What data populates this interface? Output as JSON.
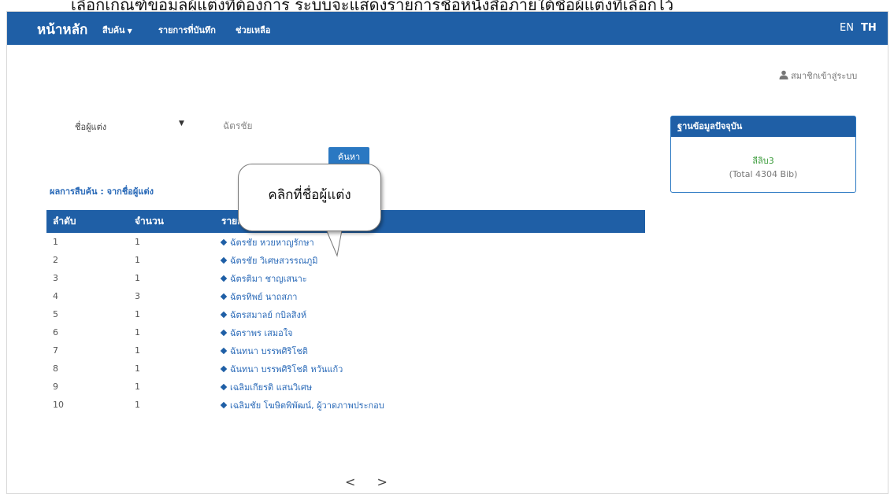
{
  "caption_fragment": "เลือกเกณฑ์ขอมูลผู้แต่งที่ต้องการ ระบบจะแสดงรายการชื่อหนังสือภายใต้ชื่อผู้แต่งที่เลือกไว้",
  "nav": {
    "brand": "หน้าหลัก",
    "search": "สืบค้น",
    "saved": "รายการที่บันทึก",
    "help": "ช่วยเหลือ",
    "lang_en": "EN",
    "lang_th": "TH"
  },
  "login": "สมาชิกเข้าสู่ระบบ",
  "search": {
    "field": "ชื่อผู้แต่ง",
    "term": "ฉัตรชัย",
    "button": "ค้นหา"
  },
  "result_caption": "ผลการสืบค้น : จากชื่อผู้แต่ง",
  "table": {
    "headers": [
      "ลำดับ",
      "จำนวน",
      "รายการ"
    ],
    "rows": [
      {
        "no": "1",
        "count": "1",
        "name": "ฉัตรชัย หวยหาญรักษา"
      },
      {
        "no": "2",
        "count": "1",
        "name": "ฉัตรชัย วิเศษสวรรณภูมิ"
      },
      {
        "no": "3",
        "count": "1",
        "name": "ฉัตรติมา ชาญเสนาะ"
      },
      {
        "no": "4",
        "count": "3",
        "name": "ฉัตรทิพย์ นาถสภา"
      },
      {
        "no": "5",
        "count": "1",
        "name": "ฉัตรสมาลย์ กบิลสิงห์"
      },
      {
        "no": "6",
        "count": "1",
        "name": "ฉัตราพร เสมอใจ"
      },
      {
        "no": "7",
        "count": "1",
        "name": "ฉันทนา บรรพศิริโชติ"
      },
      {
        "no": "8",
        "count": "1",
        "name": "ฉันทนา บรรพศิริโชติ หวันแก้ว"
      },
      {
        "no": "9",
        "count": "1",
        "name": "เฉลิมเกียรติ แสนวิเศษ"
      },
      {
        "no": "10",
        "count": "1",
        "name": "เฉลิมชัย โฆษิตพิพัฒน์, ผู้วาดภาพประกอบ"
      }
    ]
  },
  "pager": {
    "prev": "<",
    "next": ">"
  },
  "db_panel": {
    "title": "ฐานข้อมูลปัจจุบัน",
    "name": "ลีลิบ3",
    "total": "(Total 4304 Bib)"
  },
  "callout": "คลิกที่ชื่อผู้แต่ง",
  "colors": {
    "primary": "#1f5fa6",
    "link": "#2a6ab8",
    "db_name": "#3a9b3a"
  },
  "icons": [
    "user-icon",
    "caret-down-icon",
    "diamond-bullet-icon",
    "chevron-left-icon",
    "chevron-right-icon"
  ]
}
